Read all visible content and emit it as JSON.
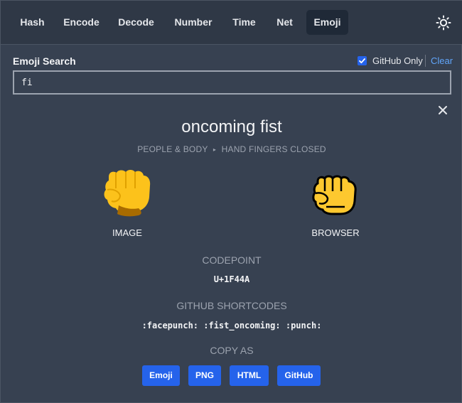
{
  "nav": {
    "tabs": [
      {
        "label": "Hash",
        "active": false
      },
      {
        "label": "Encode",
        "active": false
      },
      {
        "label": "Decode",
        "active": false
      },
      {
        "label": "Number",
        "active": false
      },
      {
        "label": "Time",
        "active": false
      },
      {
        "label": "Net",
        "active": false
      },
      {
        "label": "Emoji",
        "active": true
      }
    ],
    "theme_icon": "sun-icon"
  },
  "search": {
    "label": "Emoji Search",
    "github_only_label": "GitHub Only",
    "github_only_checked": true,
    "clear_label": "Clear",
    "value": "fi"
  },
  "emoji": {
    "name": "oncoming fist",
    "category": "PEOPLE & BODY",
    "subcategory": "HAND FINGERS CLOSED",
    "image_label": "IMAGE",
    "browser_label": "BROWSER",
    "codepoint_title": "CODEPOINT",
    "codepoint": "U+1F44A",
    "shortcodes_title": "GITHUB SHORTCODES",
    "shortcodes": ":facepunch: :fist_oncoming: :punch:",
    "copy_title": "COPY AS",
    "copy_buttons": [
      "Emoji",
      "PNG",
      "HTML",
      "GitHub"
    ]
  },
  "colors": {
    "background": "#374151",
    "nav_background": "#2f3846",
    "accent": "#2563eb",
    "link": "#60a5fa",
    "emoji_yellow": "#fcc21b"
  }
}
